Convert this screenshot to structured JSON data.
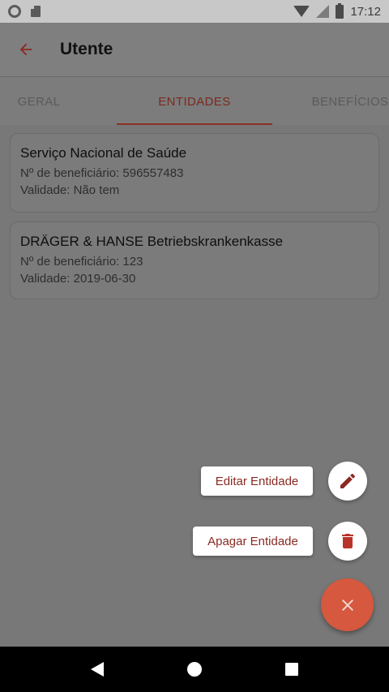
{
  "status_bar": {
    "time": "17:12"
  },
  "app_bar": {
    "title": "Utente"
  },
  "tabs": [
    {
      "label": "GERAL"
    },
    {
      "label": "ENTIDADES"
    },
    {
      "label": "BENEFÍCIOS"
    }
  ],
  "cards": [
    {
      "name": "Serviço Nacional de Saúde",
      "beneficiary": "Nº de beneficiário: 596557483",
      "validity": "Validade: Não tem"
    },
    {
      "name": "DRÄGER & HANSE Betriebskrankenkasse",
      "beneficiary": "Nº de beneficiário: 123",
      "validity": "Validade: 2019-06-30"
    }
  ],
  "fab_menu": {
    "edit_label": "Editar Entidade",
    "delete_label": "Apagar Entidade"
  },
  "colors": {
    "accent": "#d5583f",
    "accent_dark": "#8a2a22"
  },
  "icons": {
    "back": "arrow-left-icon",
    "edit": "pencil-icon",
    "delete": "trash-icon",
    "close": "close-icon"
  }
}
